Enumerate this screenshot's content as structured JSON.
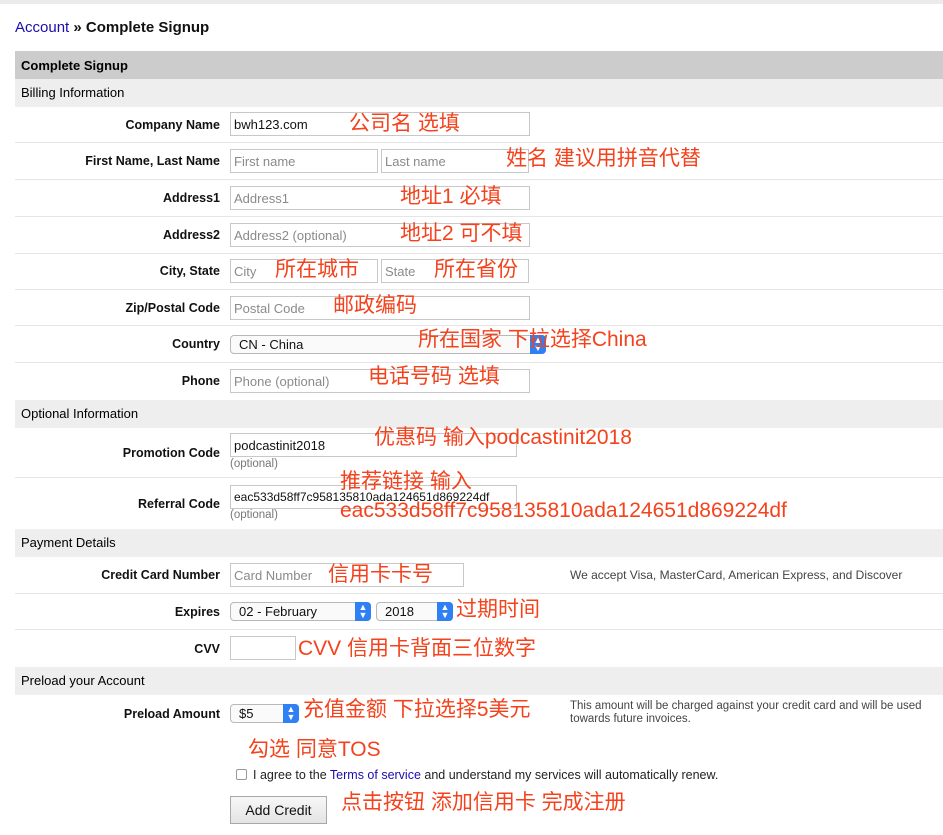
{
  "breadcrumb": {
    "link": "Account",
    "separator": "»",
    "current": "Complete Signup"
  },
  "form_title": "Complete Signup",
  "sections": {
    "billing": "Billing Information",
    "optional": "Optional Information",
    "payment": "Payment Details",
    "preload": "Preload your Account"
  },
  "fields": {
    "company": {
      "label": "Company Name",
      "value": "bwh123.com"
    },
    "name": {
      "label": "First Name, Last Name",
      "first_placeholder": "First name",
      "last_placeholder": "Last name"
    },
    "address1": {
      "label": "Address1",
      "placeholder": "Address1"
    },
    "address2": {
      "label": "Address2",
      "placeholder": "Address2 (optional)"
    },
    "city_state": {
      "label": "City, State",
      "city_placeholder": "City",
      "state_placeholder": "State"
    },
    "zip": {
      "label": "Zip/Postal Code",
      "placeholder": "Postal Code"
    },
    "country": {
      "label": "Country",
      "selected": "CN - China"
    },
    "phone": {
      "label": "Phone",
      "placeholder": "Phone (optional)"
    },
    "promo": {
      "label": "Promotion Code",
      "value": "podcastinit2018",
      "note": "(optional)"
    },
    "referral": {
      "label": "Referral Code",
      "value": "eac533d58ff7c958135810ada124651d869224df",
      "note": "(optional)"
    },
    "card": {
      "label": "Credit Card Number",
      "placeholder": "Card Number",
      "note": "We accept Visa, MasterCard, American Express, and Discover"
    },
    "expires": {
      "label": "Expires",
      "month": "02 - February",
      "year": "2018"
    },
    "cvv": {
      "label": "CVV",
      "value": ""
    },
    "preload": {
      "label": "Preload Amount",
      "selected": "$5",
      "note": "This amount will be charged against your credit card and will be used towards future invoices."
    }
  },
  "tos": {
    "prefix": "I agree to the",
    "link": "Terms of service",
    "suffix": "and understand my services will automatically renew.",
    "checked": false
  },
  "submit_label": "Add Credit",
  "annotations": {
    "company": "公司名 选填",
    "name": "姓名 建议用拼音代替",
    "address1": "地址1 必填",
    "address2": "地址2 可不填",
    "city": "所在城市",
    "state": "所在省份",
    "zip": "邮政编码",
    "country": "所在国家 下拉选择China",
    "phone": "电话号码 选填",
    "promo": "优惠码 输入podcastinit2018",
    "referral_1": "推荐链接 输入",
    "referral_2": "eac533d58ff7c958135810ada124651d869224df",
    "card": "信用卡卡号",
    "expires": "过期时间",
    "cvv": "CVV 信用卡背面三位数字",
    "preload": "充值金额 下拉选择5美元",
    "tos": "勾选 同意TOS",
    "submit": "点击按钮 添加信用卡 完成注册"
  },
  "colors": {
    "annotation": "#f4421c",
    "link": "#1a0dab",
    "header_bar": "#cccccc",
    "section_bar": "#eeeeee",
    "select_arrow": "#2f7ff5"
  }
}
